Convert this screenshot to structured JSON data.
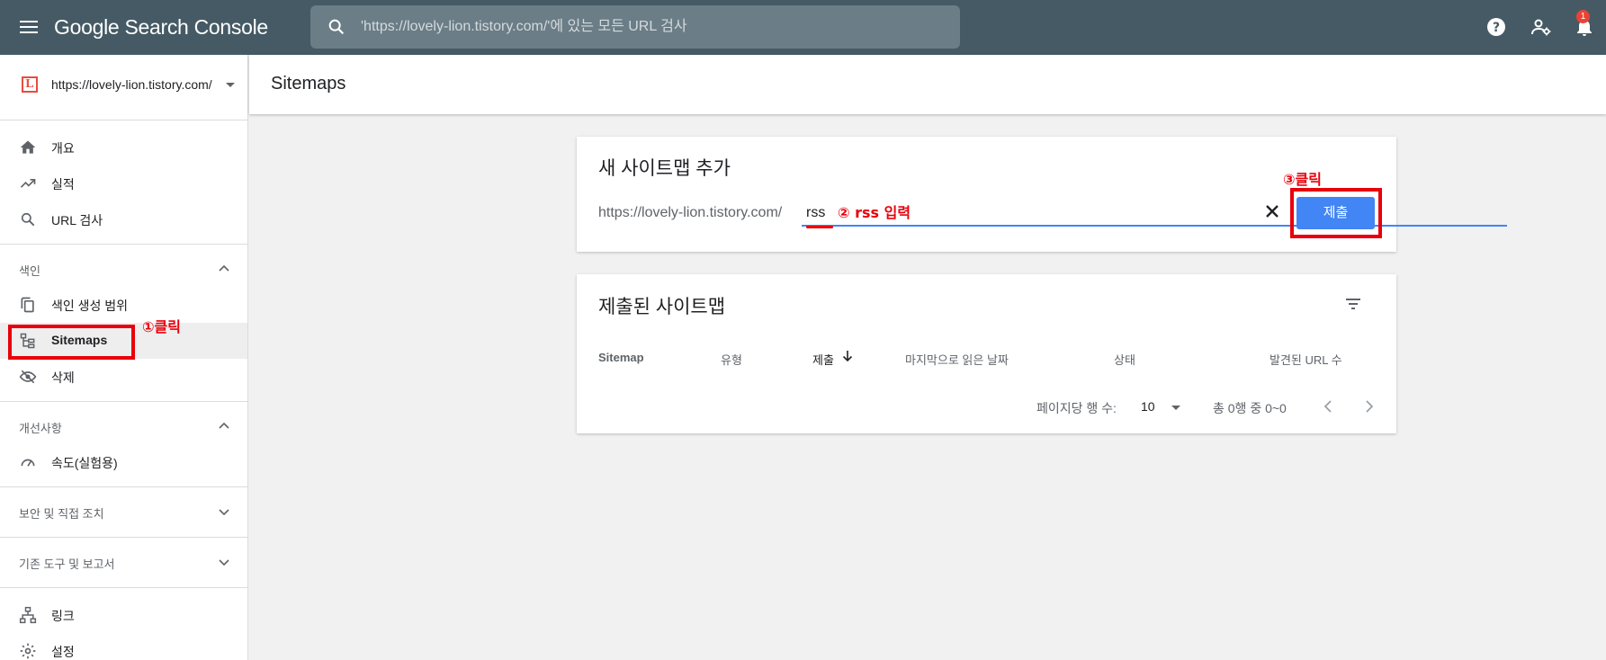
{
  "header": {
    "app_title": "Google Search Console",
    "search_placeholder": "'https://lovely-lion.tistory.com/'에 있는 모든 URL 검사",
    "notification_count": "1"
  },
  "sidebar": {
    "property_url": "https://lovely-lion.tistory.com/",
    "property_favicon_letter": "L",
    "items_top": [
      {
        "label": "개요",
        "icon": "home-icon"
      },
      {
        "label": "실적",
        "icon": "trending-up-icon"
      },
      {
        "label": "URL 검사",
        "icon": "search-icon"
      }
    ],
    "section_index": {
      "label": "색인",
      "expanded": true
    },
    "items_index": [
      {
        "label": "색인 생성 범위",
        "icon": "copy-icon"
      },
      {
        "label": "Sitemaps",
        "icon": "sitemap-icon",
        "active": true
      },
      {
        "label": "삭제",
        "icon": "eye-off-icon"
      }
    ],
    "section_enhancements": {
      "label": "개선사항",
      "expanded": true
    },
    "items_enhancements": [
      {
        "label": "속도(실험용)",
        "icon": "speed-gauge-icon"
      }
    ],
    "section_security": {
      "label": "보안 및 직접 조치",
      "expanded": false
    },
    "section_legacy": {
      "label": "기존 도구 및 보고서",
      "expanded": false
    },
    "items_bottom": [
      {
        "label": "링크",
        "icon": "links-icon"
      },
      {
        "label": "설정",
        "icon": "settings-icon"
      }
    ]
  },
  "main": {
    "page_title": "Sitemaps",
    "add_card": {
      "title": "새 사이트맵 추가",
      "url_prefix": "https://lovely-lion.tistory.com/",
      "input_value": "rss",
      "submit_label": "제출"
    },
    "submitted_card": {
      "title": "제출된 사이트맵",
      "columns": [
        "Sitemap",
        "유형",
        "제출",
        "마지막으로 읽은 날짜",
        "상태",
        "발견된 URL 수"
      ],
      "sorted_column": "제출",
      "rows_per_page_label": "페이지당 행 수:",
      "rows_per_page_value": "10",
      "range_text": "총 0행 중 0~0"
    }
  },
  "annotations": {
    "step1": "①클릭",
    "step2": "② rss 입력",
    "step3": "③클릭",
    "color": "#e8000b"
  },
  "colors": {
    "header_bg": "#455a64",
    "accent_blue": "#4285f4",
    "annotation_red": "#e8000b"
  }
}
